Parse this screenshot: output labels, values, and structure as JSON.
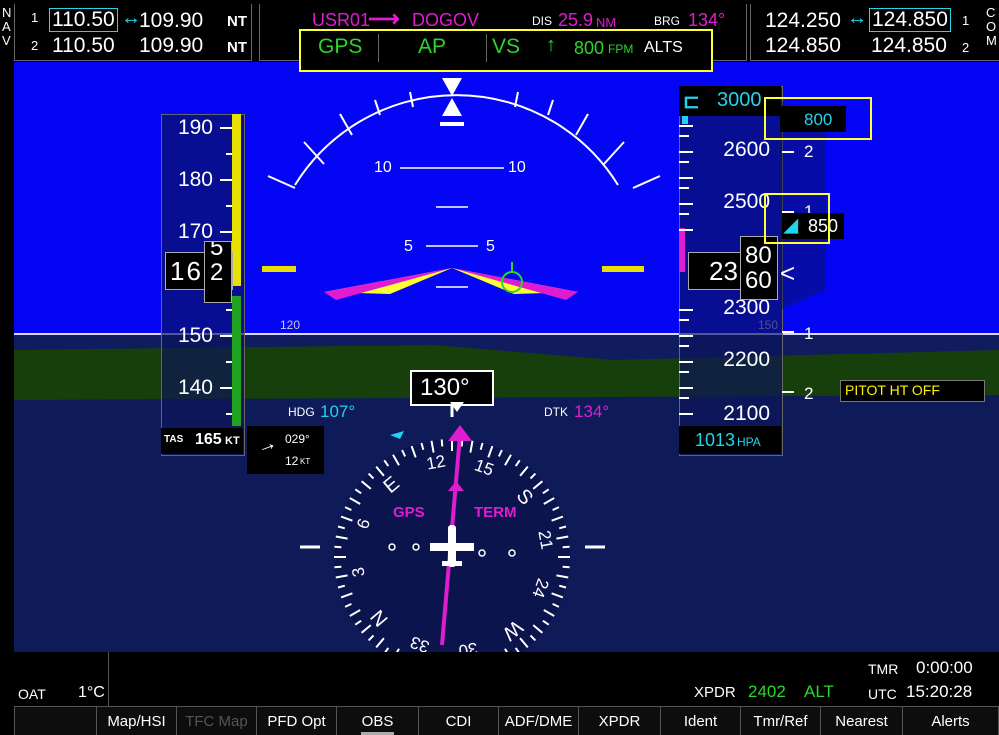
{
  "nav": {
    "side_label_n": "N",
    "side_label_a": "A",
    "side_label_v": "V",
    "row1_num": "1",
    "row2_num": "2",
    "nav1_active": "110.50",
    "nav1_standby": "109.90",
    "nav1_suffix": "NT",
    "nav2_active": "110.50",
    "nav2_standby": "109.90",
    "nav2_suffix": "NT",
    "swap_glyph": "↔"
  },
  "com": {
    "com1_active": "124.250",
    "com1_standby": "124.850",
    "com2_active": "124.850",
    "com2_standby": "124.850",
    "side_label_c": "C",
    "side_label_o": "O",
    "side_label_m": "M",
    "row1_num": "1",
    "row2_num": "2",
    "swap_glyph": "↔"
  },
  "flight_plan": {
    "from": "USR01",
    "arrow": "⟶",
    "to": "DOGOV",
    "dis_label": "DIS",
    "dis_value": "25.9",
    "dis_unit": "NM",
    "brg_label": "BRG",
    "brg_value": "134°"
  },
  "autopilot": {
    "lateral_mode": "GPS",
    "ap_status": "AP",
    "vertical_mode": "VS",
    "vs_arrow": "↑",
    "vs_value": "800",
    "vs_unit": "FPM",
    "armed_mode": "ALTS"
  },
  "airspeed": {
    "labels": [
      "190",
      "180",
      "170",
      "150",
      "140"
    ],
    "current_main": "16",
    "current_roll_top": "5",
    "current_roll_bottom": "2",
    "tas_label": "TAS",
    "tas_value": "165",
    "tas_unit": "KT"
  },
  "attitude": {
    "pitch_10_left": "10",
    "pitch_10_right": "10",
    "pitch_5_left": "5",
    "pitch_5_right": "5",
    "heading_tick_120": "120",
    "heading_tick_150": "150"
  },
  "altitude": {
    "selected": "3000",
    "labels": [
      "2600",
      "2500",
      "2300",
      "2200",
      "2100"
    ],
    "current_main": "23",
    "current_roll_top": "80",
    "current_roll_bottom": "60",
    "baro_value": "1013",
    "baro_unit": "HPA",
    "vsi_labels": [
      "2",
      "1",
      "1",
      "2"
    ],
    "vs_target": "800",
    "vs_current": "850",
    "vsi_pointer": "<"
  },
  "hsi": {
    "heading_value": "130°",
    "hdg_label": "HDG",
    "hdg_bug": "107°",
    "dtk_label": "DTK",
    "dtk_value": "134°",
    "nav_source": "GPS",
    "phase": "TERM",
    "compass_labels": [
      "E",
      "12",
      "15",
      "S",
      "21",
      "24",
      "W",
      "30",
      "33",
      "N",
      "3",
      "6"
    ],
    "wind_dir": "029°",
    "wind_speed": "12",
    "wind_unit": "KT",
    "wind_arrow": "→"
  },
  "annunciation": {
    "pitot": "PITOT HT OFF"
  },
  "bottom": {
    "oat_label": "OAT",
    "oat_value": "1°C",
    "xpdr_label": "XPDR",
    "xpdr_code": "2402",
    "xpdr_mode": "ALT",
    "tmr_label": "TMR",
    "tmr_value": "0:00:00",
    "utc_label": "UTC",
    "utc_value": "15:20:28"
  },
  "softkeys": [
    "",
    "Map/HSI",
    "TFC Map",
    "PFD Opt",
    "OBS",
    "CDI",
    "ADF/DME",
    "XPDR",
    "Ident",
    "Tmr/Ref",
    "Nearest",
    "Alerts"
  ],
  "colors": {
    "sky": "#0505f5",
    "ground": "#173f0c",
    "magenta": "#e01cd0",
    "cyan": "#22d3ee",
    "green": "#2bd52b",
    "highlight": "#ffff33"
  }
}
